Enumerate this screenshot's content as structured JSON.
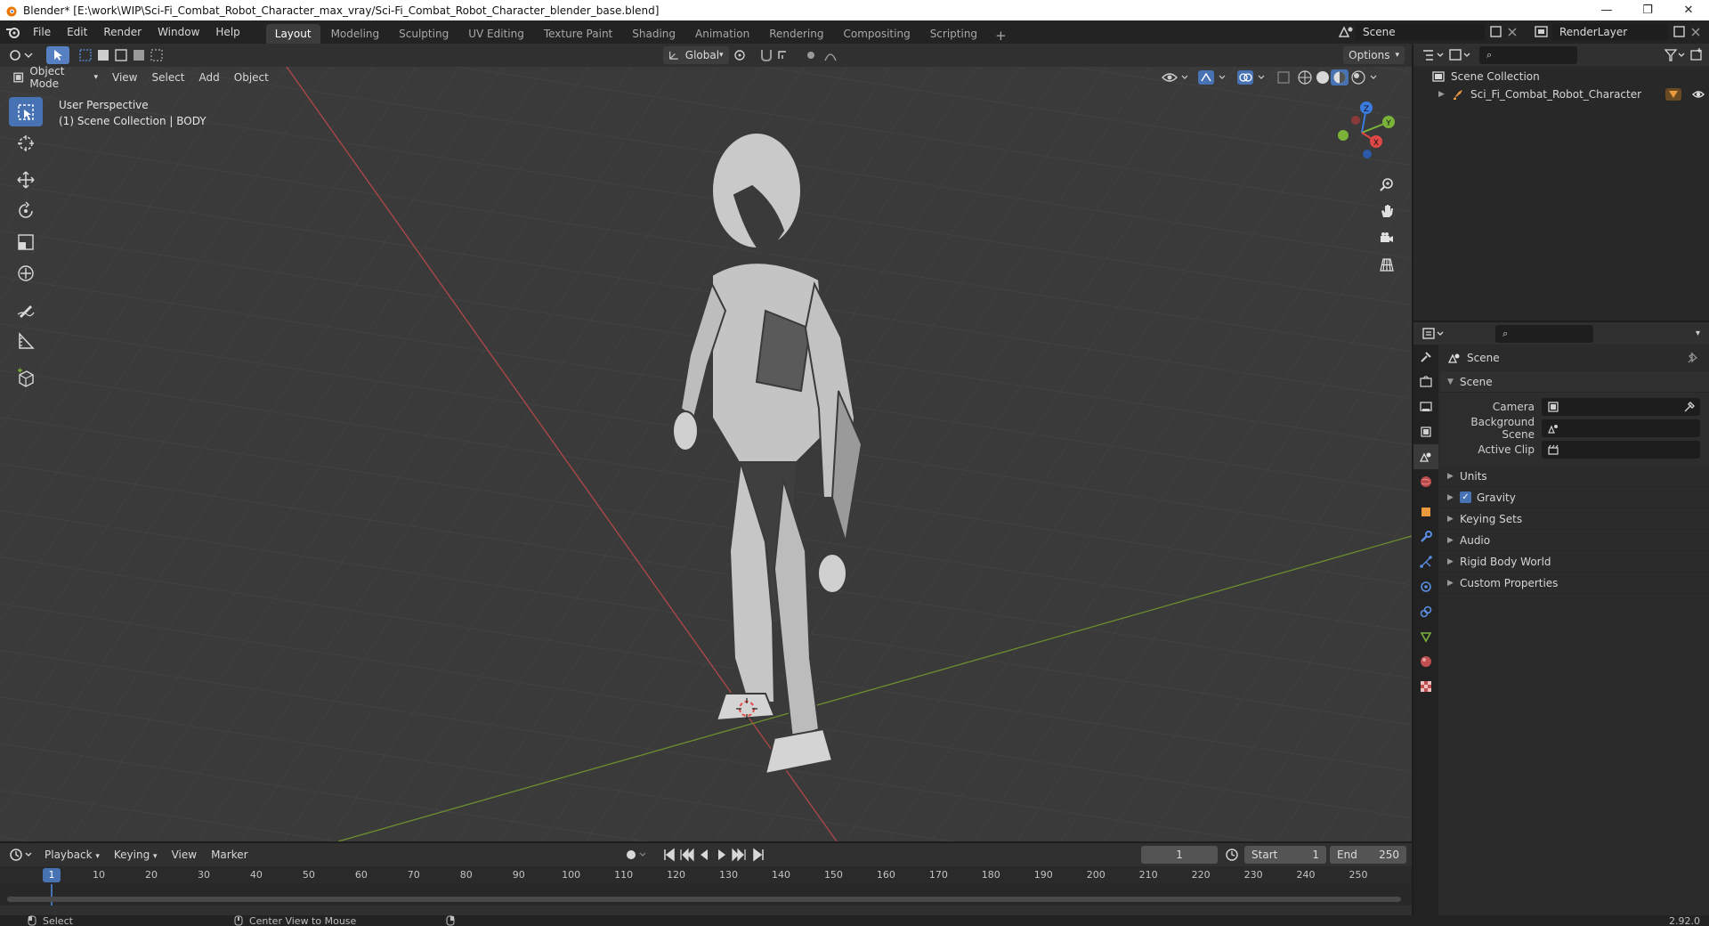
{
  "window": {
    "title": "Blender* [E:\\work\\WIP\\Sci-Fi_Combat_Robot_Character_max_vray/Sci-Fi_Combat_Robot_Character_blender_base.blend]",
    "minimize": "—",
    "maximize": "❐",
    "close": "✕"
  },
  "menu": {
    "items": [
      "File",
      "Edit",
      "Render",
      "Window",
      "Help"
    ]
  },
  "workspaces": {
    "tabs": [
      "Layout",
      "Modeling",
      "Sculpting",
      "UV Editing",
      "Texture Paint",
      "Shading",
      "Animation",
      "Rendering",
      "Compositing",
      "Scripting"
    ],
    "active": "Layout",
    "add": "+"
  },
  "scene_selector": {
    "value": "Scene"
  },
  "renderlayer_selector": {
    "value": "RenderLayer"
  },
  "viewport": {
    "mode": "Object Mode",
    "menus": [
      "View",
      "Select",
      "Add",
      "Object"
    ],
    "orientation": "Global",
    "options_label": "Options",
    "view_name": "User Perspective",
    "collection_info": "(1) Scene Collection | BODY"
  },
  "gizmo": {
    "z": "Z",
    "y": "Y",
    "x": "X"
  },
  "outliner": {
    "root": "Scene Collection",
    "items": [
      "Sci_Fi_Combat_Robot_Character"
    ]
  },
  "properties": {
    "context": "Scene",
    "section": "Scene",
    "fields": [
      {
        "label": "Camera",
        "value": ""
      },
      {
        "label": "Background Scene",
        "value": ""
      },
      {
        "label": "Active Clip",
        "value": ""
      }
    ],
    "subpanels": [
      {
        "label": "Units",
        "checkbox": false
      },
      {
        "label": "Gravity",
        "checkbox": true
      },
      {
        "label": "Keying Sets",
        "checkbox": false
      },
      {
        "label": "Audio",
        "checkbox": false
      },
      {
        "label": "Rigid Body World",
        "checkbox": false
      },
      {
        "label": "Custom Properties",
        "checkbox": false
      }
    ]
  },
  "timeline": {
    "menus": [
      "Playback",
      "Keying",
      "View",
      "Marker"
    ],
    "current_frame": "1",
    "start_label": "Start",
    "start": "1",
    "end_label": "End",
    "end": "250",
    "ruler": [
      "1",
      "10",
      "20",
      "30",
      "40",
      "50",
      "60",
      "70",
      "80",
      "90",
      "100",
      "110",
      "120",
      "130",
      "140",
      "150",
      "160",
      "170",
      "180",
      "190",
      "200",
      "210",
      "220",
      "230",
      "240",
      "250"
    ]
  },
  "status": {
    "left": "Select",
    "middle": "Center View to Mouse",
    "version": "2.92.0"
  },
  "colors": {
    "accent": "#4772b3",
    "x_axis": "#e04848",
    "y_axis": "#7bb33a",
    "z_axis": "#3b7be0"
  }
}
